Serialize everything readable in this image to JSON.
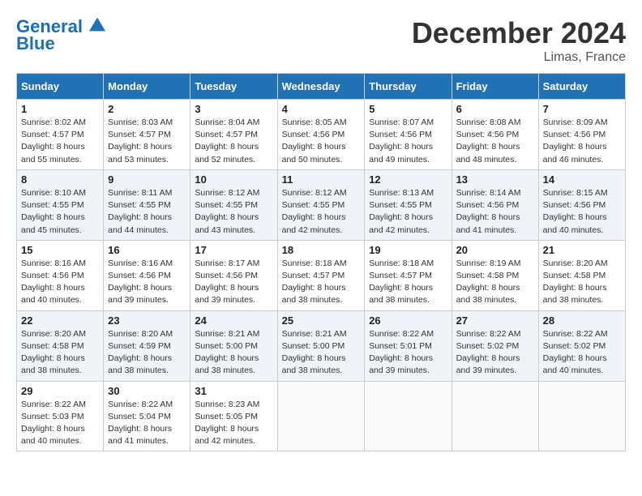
{
  "header": {
    "logo_line1": "General",
    "logo_line2": "Blue",
    "title": "December 2024",
    "subtitle": "Limas, France"
  },
  "weekdays": [
    "Sunday",
    "Monday",
    "Tuesday",
    "Wednesday",
    "Thursday",
    "Friday",
    "Saturday"
  ],
  "weeks": [
    [
      {
        "day": "1",
        "sunrise": "Sunrise: 8:02 AM",
        "sunset": "Sunset: 4:57 PM",
        "daylight": "Daylight: 8 hours and 55 minutes."
      },
      {
        "day": "2",
        "sunrise": "Sunrise: 8:03 AM",
        "sunset": "Sunset: 4:57 PM",
        "daylight": "Daylight: 8 hours and 53 minutes."
      },
      {
        "day": "3",
        "sunrise": "Sunrise: 8:04 AM",
        "sunset": "Sunset: 4:57 PM",
        "daylight": "Daylight: 8 hours and 52 minutes."
      },
      {
        "day": "4",
        "sunrise": "Sunrise: 8:05 AM",
        "sunset": "Sunset: 4:56 PM",
        "daylight": "Daylight: 8 hours and 50 minutes."
      },
      {
        "day": "5",
        "sunrise": "Sunrise: 8:07 AM",
        "sunset": "Sunset: 4:56 PM",
        "daylight": "Daylight: 8 hours and 49 minutes."
      },
      {
        "day": "6",
        "sunrise": "Sunrise: 8:08 AM",
        "sunset": "Sunset: 4:56 PM",
        "daylight": "Daylight: 8 hours and 48 minutes."
      },
      {
        "day": "7",
        "sunrise": "Sunrise: 8:09 AM",
        "sunset": "Sunset: 4:56 PM",
        "daylight": "Daylight: 8 hours and 46 minutes."
      }
    ],
    [
      {
        "day": "8",
        "sunrise": "Sunrise: 8:10 AM",
        "sunset": "Sunset: 4:55 PM",
        "daylight": "Daylight: 8 hours and 45 minutes."
      },
      {
        "day": "9",
        "sunrise": "Sunrise: 8:11 AM",
        "sunset": "Sunset: 4:55 PM",
        "daylight": "Daylight: 8 hours and 44 minutes."
      },
      {
        "day": "10",
        "sunrise": "Sunrise: 8:12 AM",
        "sunset": "Sunset: 4:55 PM",
        "daylight": "Daylight: 8 hours and 43 minutes."
      },
      {
        "day": "11",
        "sunrise": "Sunrise: 8:12 AM",
        "sunset": "Sunset: 4:55 PM",
        "daylight": "Daylight: 8 hours and 42 minutes."
      },
      {
        "day": "12",
        "sunrise": "Sunrise: 8:13 AM",
        "sunset": "Sunset: 4:55 PM",
        "daylight": "Daylight: 8 hours and 42 minutes."
      },
      {
        "day": "13",
        "sunrise": "Sunrise: 8:14 AM",
        "sunset": "Sunset: 4:56 PM",
        "daylight": "Daylight: 8 hours and 41 minutes."
      },
      {
        "day": "14",
        "sunrise": "Sunrise: 8:15 AM",
        "sunset": "Sunset: 4:56 PM",
        "daylight": "Daylight: 8 hours and 40 minutes."
      }
    ],
    [
      {
        "day": "15",
        "sunrise": "Sunrise: 8:16 AM",
        "sunset": "Sunset: 4:56 PM",
        "daylight": "Daylight: 8 hours and 40 minutes."
      },
      {
        "day": "16",
        "sunrise": "Sunrise: 8:16 AM",
        "sunset": "Sunset: 4:56 PM",
        "daylight": "Daylight: 8 hours and 39 minutes."
      },
      {
        "day": "17",
        "sunrise": "Sunrise: 8:17 AM",
        "sunset": "Sunset: 4:56 PM",
        "daylight": "Daylight: 8 hours and 39 minutes."
      },
      {
        "day": "18",
        "sunrise": "Sunrise: 8:18 AM",
        "sunset": "Sunset: 4:57 PM",
        "daylight": "Daylight: 8 hours and 38 minutes."
      },
      {
        "day": "19",
        "sunrise": "Sunrise: 8:18 AM",
        "sunset": "Sunset: 4:57 PM",
        "daylight": "Daylight: 8 hours and 38 minutes."
      },
      {
        "day": "20",
        "sunrise": "Sunrise: 8:19 AM",
        "sunset": "Sunset: 4:58 PM",
        "daylight": "Daylight: 8 hours and 38 minutes."
      },
      {
        "day": "21",
        "sunrise": "Sunrise: 8:20 AM",
        "sunset": "Sunset: 4:58 PM",
        "daylight": "Daylight: 8 hours and 38 minutes."
      }
    ],
    [
      {
        "day": "22",
        "sunrise": "Sunrise: 8:20 AM",
        "sunset": "Sunset: 4:58 PM",
        "daylight": "Daylight: 8 hours and 38 minutes."
      },
      {
        "day": "23",
        "sunrise": "Sunrise: 8:20 AM",
        "sunset": "Sunset: 4:59 PM",
        "daylight": "Daylight: 8 hours and 38 minutes."
      },
      {
        "day": "24",
        "sunrise": "Sunrise: 8:21 AM",
        "sunset": "Sunset: 5:00 PM",
        "daylight": "Daylight: 8 hours and 38 minutes."
      },
      {
        "day": "25",
        "sunrise": "Sunrise: 8:21 AM",
        "sunset": "Sunset: 5:00 PM",
        "daylight": "Daylight: 8 hours and 38 minutes."
      },
      {
        "day": "26",
        "sunrise": "Sunrise: 8:22 AM",
        "sunset": "Sunset: 5:01 PM",
        "daylight": "Daylight: 8 hours and 39 minutes."
      },
      {
        "day": "27",
        "sunrise": "Sunrise: 8:22 AM",
        "sunset": "Sunset: 5:02 PM",
        "daylight": "Daylight: 8 hours and 39 minutes."
      },
      {
        "day": "28",
        "sunrise": "Sunrise: 8:22 AM",
        "sunset": "Sunset: 5:02 PM",
        "daylight": "Daylight: 8 hours and 40 minutes."
      }
    ],
    [
      {
        "day": "29",
        "sunrise": "Sunrise: 8:22 AM",
        "sunset": "Sunset: 5:03 PM",
        "daylight": "Daylight: 8 hours and 40 minutes."
      },
      {
        "day": "30",
        "sunrise": "Sunrise: 8:22 AM",
        "sunset": "Sunset: 5:04 PM",
        "daylight": "Daylight: 8 hours and 41 minutes."
      },
      {
        "day": "31",
        "sunrise": "Sunrise: 8:23 AM",
        "sunset": "Sunset: 5:05 PM",
        "daylight": "Daylight: 8 hours and 42 minutes."
      },
      null,
      null,
      null,
      null
    ]
  ]
}
